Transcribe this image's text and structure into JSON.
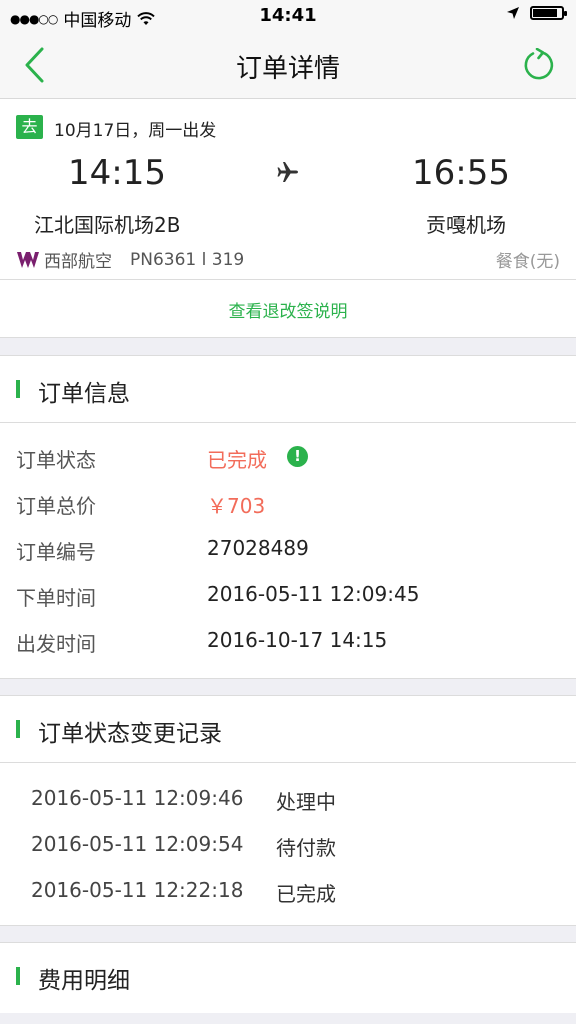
{
  "status_bar": {
    "signal": "●●●○○",
    "carrier": "中国移动",
    "time": "14:41",
    "battery_level": 0.85
  },
  "nav": {
    "title": "订单详情"
  },
  "flight": {
    "direction_badge": "去",
    "departure_date": "10月17日，周一出发",
    "departure_time": "14:15",
    "arrival_time": "16:55",
    "departure_airport": "江北国际机场2B",
    "arrival_airport": "贡嘎机场",
    "airline": "西部航空",
    "flight_number": "PN6361 l 319",
    "meal": "餐食(无)",
    "refund_link": "查看退改签说明"
  },
  "order_info": {
    "title": "订单信息",
    "rows": [
      {
        "label": "订单状态",
        "value": "已完成"
      },
      {
        "label": "订单总价",
        "value": "￥703"
      },
      {
        "label": "订单编号",
        "value": "27028489"
      },
      {
        "label": "下单时间",
        "value": "2016-05-11 12:09:45"
      },
      {
        "label": "出发时间",
        "value": "2016-10-17 14:15"
      }
    ],
    "status_alert_glyph": "!"
  },
  "status_log": {
    "title": "订单状态变更记录",
    "entries": [
      {
        "time": "2016-05-11 12:09:46",
        "status": "处理中"
      },
      {
        "time": "2016-05-11 12:09:54",
        "status": "待付款"
      },
      {
        "time": "2016-05-11 12:22:18",
        "status": "已完成"
      }
    ]
  },
  "fees": {
    "title": "费用明细"
  },
  "colors": {
    "accent": "#2bb24c",
    "price": "#f26c5a"
  }
}
